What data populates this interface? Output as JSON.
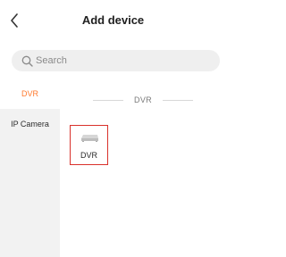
{
  "header": {
    "back_icon": "chevron-left-icon",
    "title": "Add device"
  },
  "search": {
    "icon": "search-icon",
    "placeholder": "Search",
    "value": ""
  },
  "sidebar": {
    "items": [
      {
        "label": "DVR",
        "active": true
      },
      {
        "label": "IP Camera",
        "active": false
      }
    ]
  },
  "content": {
    "section_title": "DVR",
    "devices": [
      {
        "label": "DVR",
        "icon": "dvr-device-icon",
        "selected": true
      }
    ]
  },
  "colors": {
    "accent": "#ff7a2e",
    "selection_border": "#d9312b"
  }
}
